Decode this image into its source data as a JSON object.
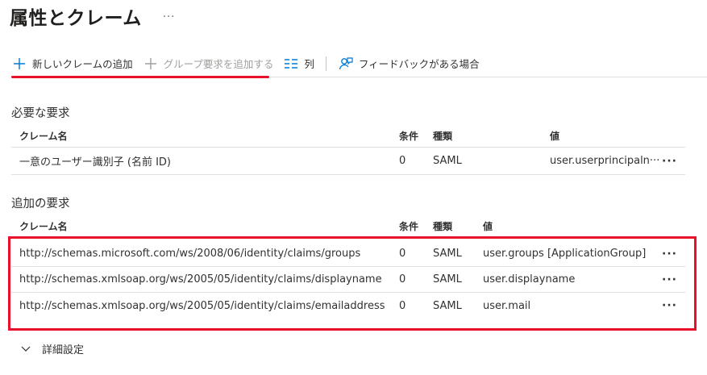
{
  "page": {
    "title": "属性とクレーム",
    "more_label": "···"
  },
  "toolbar": {
    "add_claim": "新しいクレームの追加",
    "add_group_claim": "グループ要求を追加する",
    "columns": "列",
    "feedback": "フィードバックがある場合"
  },
  "required": {
    "section_title": "必要な要求",
    "headers": {
      "name": "クレーム名",
      "condition": "条件",
      "type": "種類",
      "value": "値"
    },
    "rows": [
      {
        "name": "一意のユーザー識別子 (名前 ID)",
        "condition": "0",
        "type": "SAML",
        "value": "user.userprincipaln···",
        "more": "···"
      }
    ]
  },
  "additional": {
    "section_title": "追加の要求",
    "headers": {
      "name": "クレーム名",
      "condition": "条件",
      "type": "種類",
      "value": "値"
    },
    "rows": [
      {
        "name": "http://schemas.microsoft.com/ws/2008/06/identity/claims/groups",
        "condition": "0",
        "type": "SAML",
        "value": "user.groups [ApplicationGroup]",
        "more": "···"
      },
      {
        "name": "http://schemas.xmlsoap.org/ws/2005/05/identity/claims/displayname",
        "condition": "0",
        "type": "SAML",
        "value": "user.displayname",
        "more": "···"
      },
      {
        "name": "http://schemas.xmlsoap.org/ws/2005/05/identity/claims/emailaddress",
        "condition": "0",
        "type": "SAML",
        "value": "user.mail",
        "more": "···"
      }
    ]
  },
  "advanced": {
    "label": "詳細設定"
  },
  "colors": {
    "accent": "#0078d4",
    "highlight": "#e8102a",
    "border": "#e1dfdd"
  }
}
